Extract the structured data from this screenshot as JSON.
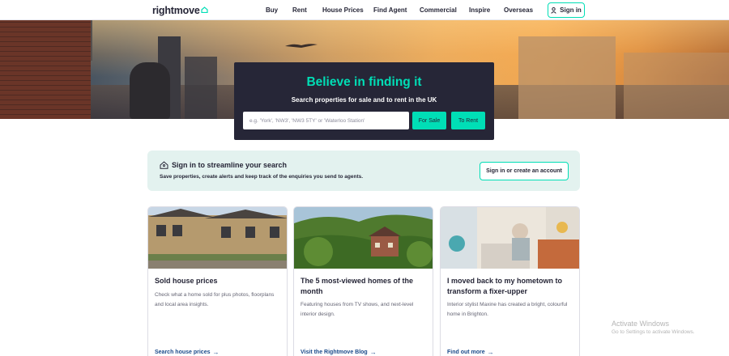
{
  "header": {
    "logo_text": "rightmove",
    "nav": [
      "Buy",
      "Rent",
      "House Prices",
      "Find Agent",
      "Commercial",
      "Inspire",
      "Overseas"
    ],
    "sign_in_label": "Sign in"
  },
  "hero": {
    "title": "Believe in finding it",
    "subtitle": "Search properties for sale and to rent in the UK",
    "search_placeholder": "e.g. 'York', 'NW3', 'NW3 5TY' or 'Waterloo Station'",
    "for_sale_label": "For Sale",
    "to_rent_label": "To Rent"
  },
  "signin_panel": {
    "title": "Sign in to streamline your search",
    "description": "Save properties, create alerts and keep track of the enquiries you send to agents.",
    "button_label": "Sign in or create an account"
  },
  "cards": [
    {
      "title": "Sold house prices",
      "description": "Check what a home sold for plus photos, floorplans and local area insights.",
      "link": "Search house prices"
    },
    {
      "title": "The 5 most-viewed homes of the month",
      "description": "Featuring houses from TV shows, and next-level interior design.",
      "link": "Visit the Rightmove Blog"
    },
    {
      "title": "I moved back to my hometown to transform a fixer-upper",
      "description": "Interior stylist Maxine has created a bright, colourful home in Brighton.",
      "link": "Find out more"
    }
  ],
  "watermark": {
    "line1": "Activate Windows",
    "line2": "Go to Settings to activate Windows."
  },
  "colors": {
    "accent": "#00deb6",
    "dark": "#262637",
    "panel_bg": "#e3f2ef",
    "link": "#1a4a8a"
  }
}
